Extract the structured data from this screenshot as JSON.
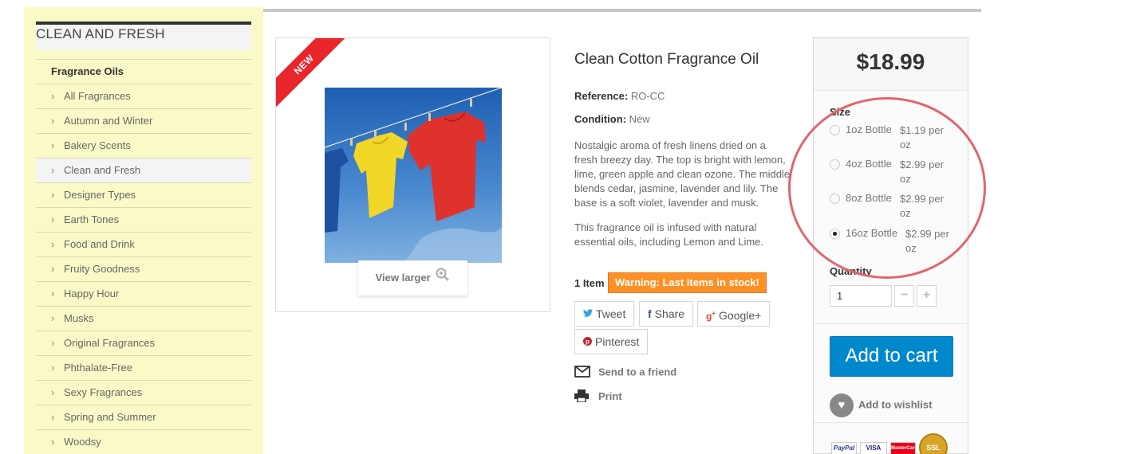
{
  "sidebar": {
    "title": "CLEAN AND FRESH",
    "heading": "Fragrance Oils",
    "items": [
      {
        "label": "All Fragrances"
      },
      {
        "label": "Autumn and Winter"
      },
      {
        "label": "Bakery Scents"
      },
      {
        "label": "Clean and Fresh",
        "active": true
      },
      {
        "label": "Designer Types"
      },
      {
        "label": "Earth Tones"
      },
      {
        "label": "Food and Drink"
      },
      {
        "label": "Fruity Goodness"
      },
      {
        "label": "Happy Hour"
      },
      {
        "label": "Musks"
      },
      {
        "label": "Original Fragrances"
      },
      {
        "label": "Phthalate-Free"
      },
      {
        "label": "Sexy Fragrances"
      },
      {
        "label": "Spring and Summer"
      },
      {
        "label": "Woodsy"
      }
    ]
  },
  "product": {
    "ribbon": "NEW",
    "view_larger": "View larger",
    "title": "Clean Cotton Fragrance Oil",
    "reference_label": "Reference:",
    "reference": "RO-CC",
    "condition_label": "Condition:",
    "condition": "New",
    "description_lines": [
      "Nostalgic aroma of fresh linens dried on a",
      "fresh breezy day. The top is bright with lemon,",
      "lime, green apple and clean ozone. The middle",
      "blends cedar, jasmine, lavender and lily. The",
      "base is a soft violet, lavender and musk."
    ],
    "infusion_lines": [
      "This fragrance oil is infused with natural",
      "essential oils, including Lemon and Lime."
    ],
    "stock_count": "1 Item",
    "stock_warning": "Warning: Last items in stock!"
  },
  "share": {
    "tweet": "Tweet",
    "share": "Share",
    "google": "Google+",
    "pinterest": "Pinterest",
    "send_friend": "Send to a friend",
    "print": "Print"
  },
  "buy_box": {
    "price": "$18.99",
    "size_label": "Size",
    "options": [
      {
        "name": "1oz Bottle",
        "per_line1": "$1.19 per",
        "per_line2": "oz",
        "checked": false
      },
      {
        "name": "4oz Bottle",
        "per_line1": "$2.99 per",
        "per_line2": "oz",
        "checked": false
      },
      {
        "name": "8oz Bottle",
        "per_line1": "$2.99 per",
        "per_line2": "oz",
        "checked": false
      },
      {
        "name": "16oz Bottle",
        "per_line1": "$2.99 per",
        "per_line2": "oz",
        "checked": true
      }
    ],
    "quantity_label": "Quantity",
    "quantity_value": "1",
    "minus": "−",
    "plus": "+",
    "add_to_cart": "Add to cart",
    "wishlist": "Add to wishlist",
    "payment_logos": [
      "PayPal",
      "VISA",
      "MasterCard",
      "SSL"
    ]
  },
  "colors": {
    "sidebar_bg": "#fafac8",
    "cart_button": "#0088cc",
    "warning": "#fe9126",
    "ribbon": "#e9262a",
    "annotation": "#e06670"
  }
}
